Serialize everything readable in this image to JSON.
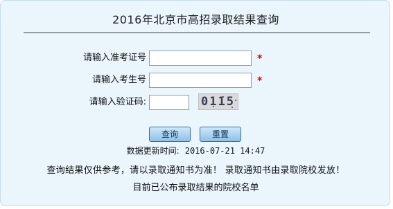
{
  "page": {
    "title": "2016年北京市高招录取结果查询"
  },
  "form": {
    "admission_ticket_label": "请输入准考证号",
    "admission_ticket_value": "",
    "exam_number_label": "请输入考生号",
    "exam_number_value": "",
    "captcha_label": "请输入验证码:",
    "captcha_value": "",
    "captcha_code": "0115",
    "required_mark": "*"
  },
  "buttons": {
    "query": "查询",
    "reset": "重置"
  },
  "footer": {
    "update_label": "数据更新时间:",
    "update_time": "2016-07-21 14:47",
    "notice": "查询结果仅供参考，请以录取通知书为准！  录取通知书由录取院校发放！",
    "school_list_link": "目前已公布录取结果的院校名单"
  },
  "colors": {
    "background": "#ebf5fc",
    "required": "#e60000",
    "button": "#8fc0e8"
  }
}
